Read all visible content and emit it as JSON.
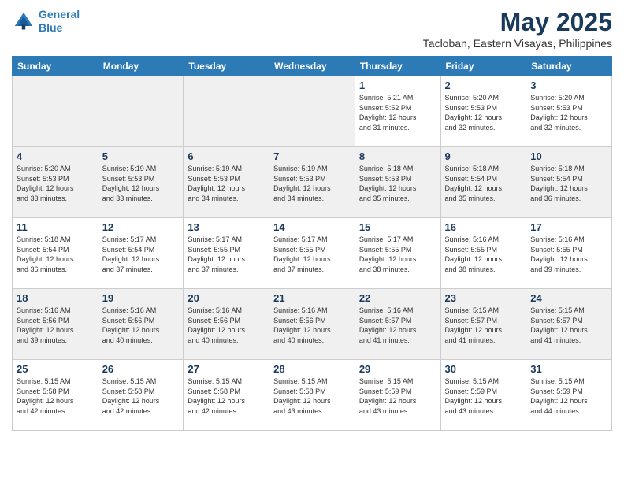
{
  "header": {
    "logo_line1": "General",
    "logo_line2": "Blue",
    "month": "May 2025",
    "location": "Tacloban, Eastern Visayas, Philippines"
  },
  "days_of_week": [
    "Sunday",
    "Monday",
    "Tuesday",
    "Wednesday",
    "Thursday",
    "Friday",
    "Saturday"
  ],
  "weeks": [
    [
      {
        "day": "",
        "info": ""
      },
      {
        "day": "",
        "info": ""
      },
      {
        "day": "",
        "info": ""
      },
      {
        "day": "",
        "info": ""
      },
      {
        "day": "1",
        "info": "Sunrise: 5:21 AM\nSunset: 5:52 PM\nDaylight: 12 hours\nand 31 minutes."
      },
      {
        "day": "2",
        "info": "Sunrise: 5:20 AM\nSunset: 5:53 PM\nDaylight: 12 hours\nand 32 minutes."
      },
      {
        "day": "3",
        "info": "Sunrise: 5:20 AM\nSunset: 5:53 PM\nDaylight: 12 hours\nand 32 minutes."
      }
    ],
    [
      {
        "day": "4",
        "info": "Sunrise: 5:20 AM\nSunset: 5:53 PM\nDaylight: 12 hours\nand 33 minutes."
      },
      {
        "day": "5",
        "info": "Sunrise: 5:19 AM\nSunset: 5:53 PM\nDaylight: 12 hours\nand 33 minutes."
      },
      {
        "day": "6",
        "info": "Sunrise: 5:19 AM\nSunset: 5:53 PM\nDaylight: 12 hours\nand 34 minutes."
      },
      {
        "day": "7",
        "info": "Sunrise: 5:19 AM\nSunset: 5:53 PM\nDaylight: 12 hours\nand 34 minutes."
      },
      {
        "day": "8",
        "info": "Sunrise: 5:18 AM\nSunset: 5:53 PM\nDaylight: 12 hours\nand 35 minutes."
      },
      {
        "day": "9",
        "info": "Sunrise: 5:18 AM\nSunset: 5:54 PM\nDaylight: 12 hours\nand 35 minutes."
      },
      {
        "day": "10",
        "info": "Sunrise: 5:18 AM\nSunset: 5:54 PM\nDaylight: 12 hours\nand 36 minutes."
      }
    ],
    [
      {
        "day": "11",
        "info": "Sunrise: 5:18 AM\nSunset: 5:54 PM\nDaylight: 12 hours\nand 36 minutes."
      },
      {
        "day": "12",
        "info": "Sunrise: 5:17 AM\nSunset: 5:54 PM\nDaylight: 12 hours\nand 37 minutes."
      },
      {
        "day": "13",
        "info": "Sunrise: 5:17 AM\nSunset: 5:55 PM\nDaylight: 12 hours\nand 37 minutes."
      },
      {
        "day": "14",
        "info": "Sunrise: 5:17 AM\nSunset: 5:55 PM\nDaylight: 12 hours\nand 37 minutes."
      },
      {
        "day": "15",
        "info": "Sunrise: 5:17 AM\nSunset: 5:55 PM\nDaylight: 12 hours\nand 38 minutes."
      },
      {
        "day": "16",
        "info": "Sunrise: 5:16 AM\nSunset: 5:55 PM\nDaylight: 12 hours\nand 38 minutes."
      },
      {
        "day": "17",
        "info": "Sunrise: 5:16 AM\nSunset: 5:55 PM\nDaylight: 12 hours\nand 39 minutes."
      }
    ],
    [
      {
        "day": "18",
        "info": "Sunrise: 5:16 AM\nSunset: 5:56 PM\nDaylight: 12 hours\nand 39 minutes."
      },
      {
        "day": "19",
        "info": "Sunrise: 5:16 AM\nSunset: 5:56 PM\nDaylight: 12 hours\nand 40 minutes."
      },
      {
        "day": "20",
        "info": "Sunrise: 5:16 AM\nSunset: 5:56 PM\nDaylight: 12 hours\nand 40 minutes."
      },
      {
        "day": "21",
        "info": "Sunrise: 5:16 AM\nSunset: 5:56 PM\nDaylight: 12 hours\nand 40 minutes."
      },
      {
        "day": "22",
        "info": "Sunrise: 5:16 AM\nSunset: 5:57 PM\nDaylight: 12 hours\nand 41 minutes."
      },
      {
        "day": "23",
        "info": "Sunrise: 5:15 AM\nSunset: 5:57 PM\nDaylight: 12 hours\nand 41 minutes."
      },
      {
        "day": "24",
        "info": "Sunrise: 5:15 AM\nSunset: 5:57 PM\nDaylight: 12 hours\nand 41 minutes."
      }
    ],
    [
      {
        "day": "25",
        "info": "Sunrise: 5:15 AM\nSunset: 5:58 PM\nDaylight: 12 hours\nand 42 minutes."
      },
      {
        "day": "26",
        "info": "Sunrise: 5:15 AM\nSunset: 5:58 PM\nDaylight: 12 hours\nand 42 minutes."
      },
      {
        "day": "27",
        "info": "Sunrise: 5:15 AM\nSunset: 5:58 PM\nDaylight: 12 hours\nand 42 minutes."
      },
      {
        "day": "28",
        "info": "Sunrise: 5:15 AM\nSunset: 5:58 PM\nDaylight: 12 hours\nand 43 minutes."
      },
      {
        "day": "29",
        "info": "Sunrise: 5:15 AM\nSunset: 5:59 PM\nDaylight: 12 hours\nand 43 minutes."
      },
      {
        "day": "30",
        "info": "Sunrise: 5:15 AM\nSunset: 5:59 PM\nDaylight: 12 hours\nand 43 minutes."
      },
      {
        "day": "31",
        "info": "Sunrise: 5:15 AM\nSunset: 5:59 PM\nDaylight: 12 hours\nand 44 minutes."
      }
    ]
  ]
}
